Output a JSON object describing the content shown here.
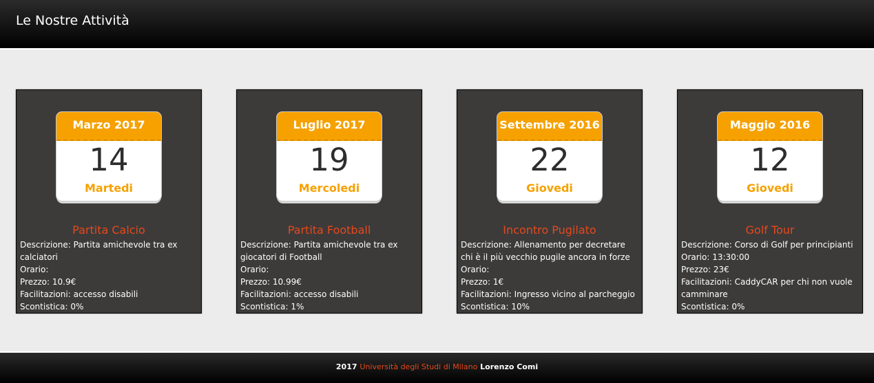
{
  "header": {
    "title": "Le Nostre Attività"
  },
  "labels": {
    "descrizione": "Descrizione:",
    "orario": "Orario:",
    "prezzo": "Prezzo:",
    "facilitazioni": "Facilitazioni:",
    "scontistica": "Scontistica:"
  },
  "cards": [
    {
      "month": "Marzo 2017",
      "day": "14",
      "weekday": "Martedi",
      "title": "Partita Calcio",
      "descrizione": "Partita amichevole tra ex calciatori",
      "orario": "",
      "prezzo": "10.9€",
      "facilitazioni": "accesso disabili",
      "scontistica": "0%"
    },
    {
      "month": "Luglio 2017",
      "day": "19",
      "weekday": "Mercoledi",
      "title": "Partita Football",
      "descrizione": "Partita amichevole tra ex giocatori di Football",
      "orario": "",
      "prezzo": "10.99€",
      "facilitazioni": "accesso disabili",
      "scontistica": "1%"
    },
    {
      "month": "Settembre 2016",
      "day": "22",
      "weekday": "Giovedi",
      "title": "Incontro Pugilato",
      "descrizione": "Allenamento per decretare chi è il più vecchio pugile ancora in forze",
      "orario": "",
      "prezzo": "1€",
      "facilitazioni": "Ingresso vicino al parcheggio",
      "scontistica": "10%"
    },
    {
      "month": "Maggio 2016",
      "day": "12",
      "weekday": "Giovedi",
      "title": "Golf Tour",
      "descrizione": "Corso di Golf per principianti",
      "orario": "13:30:00",
      "prezzo": "23€",
      "facilitazioni": "CaddyCAR per chi non vuole camminare",
      "scontistica": "0%"
    }
  ],
  "footer": {
    "year": "2017",
    "university": "Università degli Studi di Milano",
    "author": "Lorenzo Comi"
  },
  "colors": {
    "accent": "#f6a100",
    "title_red": "#e8481c",
    "card_bg": "#3c3b3a"
  }
}
